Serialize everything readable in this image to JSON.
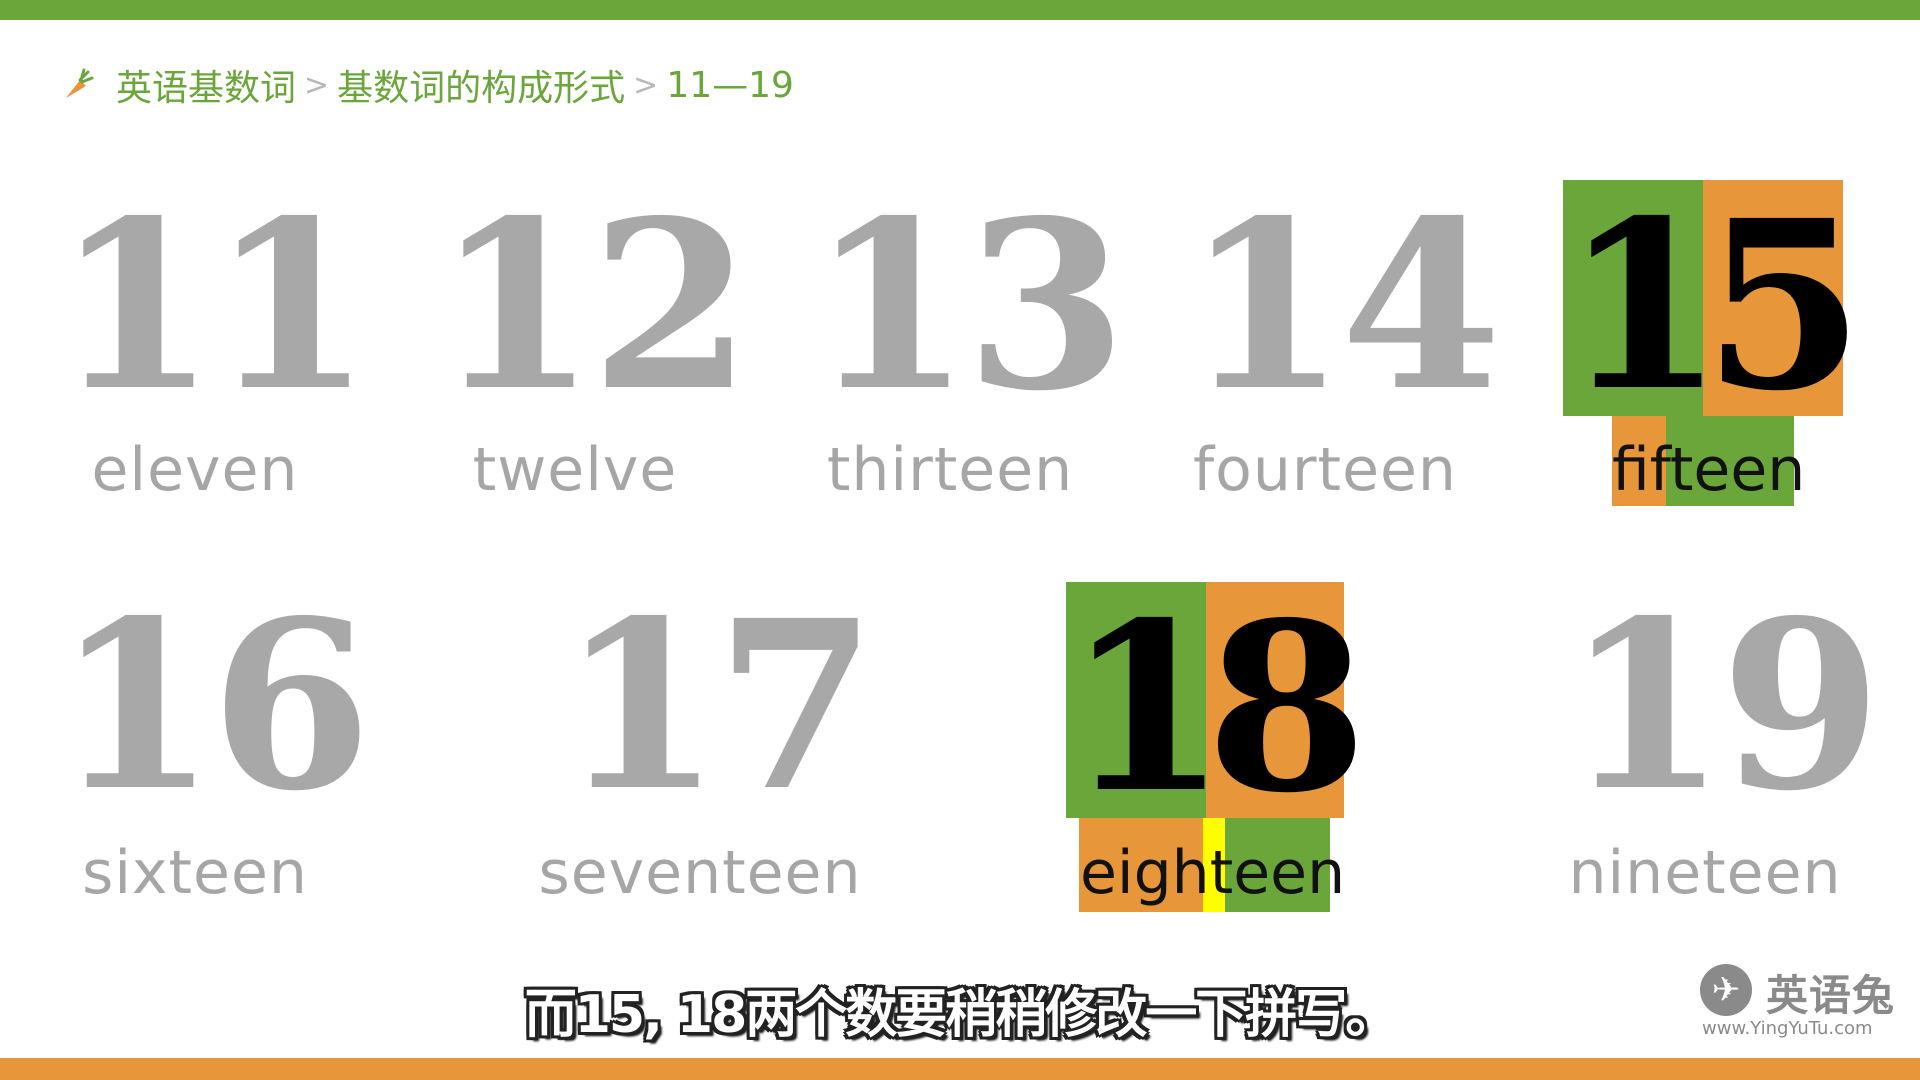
{
  "breadcrumb": {
    "icon": "carrot-icon",
    "part1": "英语基数词",
    "sep": ">",
    "part2": "基数词的构成形式",
    "part3": "11—19"
  },
  "colors": {
    "green": "#6aa63a",
    "orange": "#e8963a",
    "yellow": "#ffff00",
    "gray": "#a8a8a8"
  },
  "numbers": [
    {
      "num": "11",
      "word": "eleven"
    },
    {
      "num": "12",
      "word": "twelve"
    },
    {
      "num": "13",
      "word": "thirteen"
    },
    {
      "num": "14",
      "word": "fourteen"
    },
    {
      "num": "15",
      "word": "fifteen",
      "digit1": "1",
      "digit2": "5",
      "part_a": "fif",
      "part_b": "teen"
    },
    {
      "num": "16",
      "word": "sixteen"
    },
    {
      "num": "17",
      "word": "seventeen"
    },
    {
      "num": "18",
      "word": "eighteen",
      "digit1": "1",
      "digit2": "8",
      "part_a": "eigh",
      "part_t": "t",
      "part_b": "een"
    },
    {
      "num": "19",
      "word": "nineteen"
    }
  ],
  "subtitle": "而15, 18两个数要稍稍修改一下拼写。",
  "logo": {
    "icon": "rabbit-icon",
    "name": "英语兔",
    "url": "www.YingYuTu.com"
  }
}
